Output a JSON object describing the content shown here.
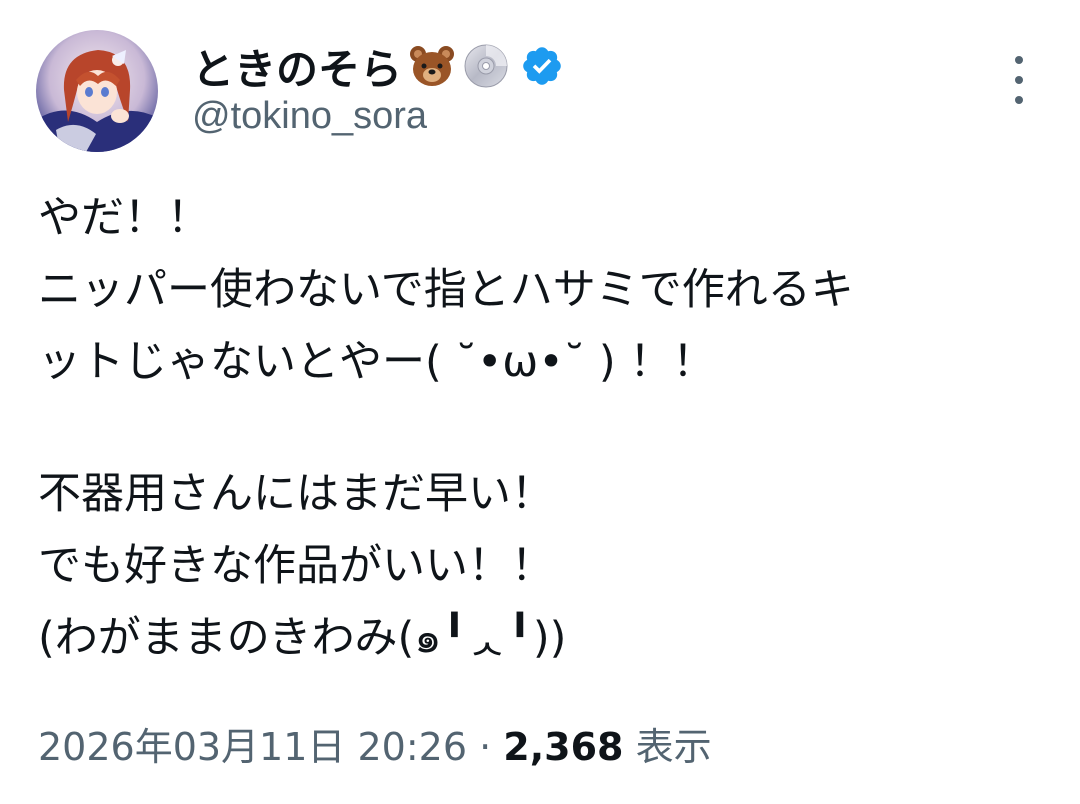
{
  "author": {
    "display_name": "ときのそら",
    "name_emojis": [
      "bear-face-emoji",
      "dvd-disc-emoji"
    ],
    "verified": true,
    "handle": "@tokino_sora"
  },
  "tweet": {
    "lines": [
      "やだ！！",
      "ニッパー使わないで指とハサミで作れるキ",
      "ットじゃないとやー( ˘•ω•˘ ) ！！",
      "",
      "不器用さんにはまだ早い！",
      "でも好きな作品がいい！！",
      "(わがままのきわみ(๑╹ᆺ╹))"
    ]
  },
  "meta": {
    "datetime": "2026年03月11日 20:26",
    "separator": "·",
    "views_count": "2,368",
    "views_label": "表示"
  },
  "colors": {
    "text_primary": "#0f1419",
    "text_secondary": "#536471",
    "verified_blue": "#1d9bf0"
  }
}
